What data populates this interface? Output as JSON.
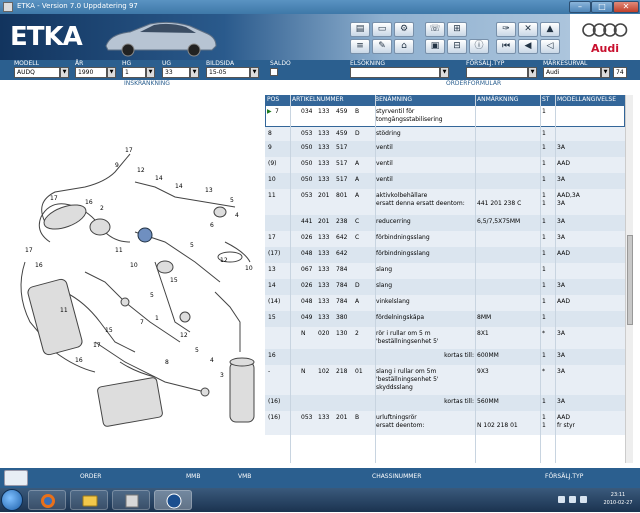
{
  "window": {
    "title": "ETKA - Version 7.0 Uppdatering 97"
  },
  "header": {
    "logo": "ETKA",
    "brand": "Audi"
  },
  "fields": {
    "modell": {
      "label": "MODELL",
      "value": "AUDQ"
    },
    "ar": {
      "label": "ÅR",
      "value": "1990"
    },
    "hg": {
      "label": "HG",
      "value": "1"
    },
    "ug": {
      "label": "UG",
      "value": "33"
    },
    "bildsida": {
      "label": "BILDSIDA",
      "value": "15-05"
    },
    "saldo": {
      "label": "SALDO"
    },
    "elsokning": {
      "label": "ELSÖKNING",
      "value": ""
    },
    "forsalj_typ": {
      "label": "FÖRSÄLJ.TYP",
      "value": ""
    },
    "markesurval": {
      "label": "MÄRKESURVAL",
      "value": "Audi",
      "extra": "74"
    }
  },
  "subheader": {
    "left": "INSKRÄNKNING",
    "right": "ORDERFORMULÄR"
  },
  "table": {
    "columns": [
      "POS",
      "ARTIKELNUMMER",
      "BENÄMNING",
      "ANMÄRKNING",
      "ST",
      "MODELLANGIVELSE"
    ],
    "rows": [
      {
        "pos": "7",
        "nr": [
          "034",
          "133",
          "459",
          "B"
        ],
        "name": "styrventil för",
        "name2": "tomgångsstabilisering",
        "ann": "",
        "st": "1",
        "mod": "",
        "selected": true
      },
      {
        "pos": "8",
        "nr": [
          "053",
          "133",
          "459",
          "D"
        ],
        "name": "stödring",
        "ann": "",
        "st": "1",
        "mod": ""
      },
      {
        "pos": "9",
        "nr": [
          "050",
          "133",
          "517",
          ""
        ],
        "name": "ventil",
        "ann": "",
        "st": "1",
        "mod": "3A"
      },
      {
        "pos": "(9)",
        "nr": [
          "050",
          "133",
          "517",
          "A"
        ],
        "name": "ventil",
        "ann": "",
        "st": "1",
        "mod": "AAD"
      },
      {
        "pos": "10",
        "nr": [
          "050",
          "133",
          "517",
          "A"
        ],
        "name": "ventil",
        "ann": "",
        "st": "1",
        "mod": "3A"
      },
      {
        "pos": "11",
        "nr": [
          "053",
          "201",
          "801",
          "A"
        ],
        "name": "aktivkolbehållare",
        "name2": "ersatt denna  ersatt deentom:",
        "ann": "441 201 238 C",
        "st": "1",
        "st2": "1",
        "mod": "AAD,3A",
        "mod2": "3A"
      },
      {
        "pos": "",
        "nr": [
          "441",
          "201",
          "238",
          "C"
        ],
        "name": "reducerring",
        "ann": "6,5/7,5X75MM",
        "st": "1",
        "mod": "3A"
      },
      {
        "pos": "17",
        "nr": [
          "026",
          "133",
          "642",
          "C"
        ],
        "name": "förbindningsslang",
        "ann": "",
        "st": "1",
        "mod": "3A"
      },
      {
        "pos": "(17)",
        "nr": [
          "048",
          "133",
          "642",
          ""
        ],
        "name": "förbindningsslang",
        "ann": "",
        "st": "1",
        "mod": "AAD"
      },
      {
        "pos": "13",
        "nr": [
          "067",
          "133",
          "784",
          ""
        ],
        "name": "slang",
        "ann": "",
        "st": "1",
        "mod": ""
      },
      {
        "pos": "14",
        "nr": [
          "026",
          "133",
          "784",
          "D"
        ],
        "name": "slang",
        "ann": "",
        "st": "1",
        "mod": "3A"
      },
      {
        "pos": "(14)",
        "nr": [
          "048",
          "133",
          "784",
          "A"
        ],
        "name": "vinkelslang",
        "ann": "",
        "st": "1",
        "mod": "AAD"
      },
      {
        "pos": "15",
        "nr": [
          "049",
          "133",
          "380",
          ""
        ],
        "name": "fördelningskåpa",
        "ann": "8MM",
        "st": "1",
        "mod": ""
      },
      {
        "pos": "",
        "nr": [
          "N",
          "020",
          "130",
          "2"
        ],
        "name": "rör i rullar om 5 m",
        "name2": "'beställningsenhet 5'",
        "ann": "8X1",
        "st": "*",
        "mod": "3A"
      },
      {
        "pos": "16",
        "nr": [
          "",
          "",
          "",
          ""
        ],
        "name": "kortas till:",
        "ann": "600MM",
        "st": "1",
        "mod": "3A",
        "right": true
      },
      {
        "pos": "-",
        "nr": [
          "N",
          "102",
          "218",
          "01"
        ],
        "name": "slang i rullar om 5m",
        "name2": "'beställningsenhet 5'",
        "name3": "skyddsslang",
        "ann": "9X3",
        "st": "*",
        "mod": "3A"
      },
      {
        "pos": "(16)",
        "nr": [
          "",
          "",
          "",
          ""
        ],
        "name": "kortas till:",
        "ann": "560MM",
        "st": "1",
        "mod": "3A",
        "right": true
      },
      {
        "pos": "(16)",
        "nr": [
          "053",
          "133",
          "201",
          "B"
        ],
        "name": "urluftningsrör",
        "name2": "ersatt deentom:",
        "ann": "N  102 218 01",
        "st": "1",
        "st2": "1",
        "mod": "AAD",
        "mod2": "fr styr"
      }
    ]
  },
  "bottom_tabs": [
    "ORDER",
    "MMB",
    "VMB",
    "CHASSINUMMER",
    "FÖRSÄLJ.TYP"
  ],
  "taskbar": {
    "time": "23:11",
    "date": "2010-02-27"
  },
  "colors": {
    "header_blue": "#2b5f8f",
    "table_header": "#336699",
    "selected_row": "#ffffff",
    "audi_red": "#c8102e"
  }
}
